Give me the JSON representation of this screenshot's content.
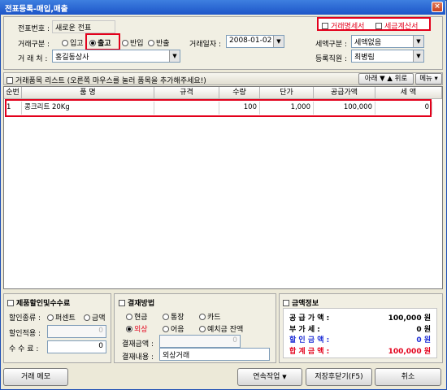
{
  "window": {
    "title": "전표등록-매입,매출",
    "close": "×"
  },
  "header": {
    "slip_no_label": "전표번호 :",
    "slip_no_value": "새로운 전표",
    "trade_type_label": "거래구분 :",
    "trade_types": [
      "입고",
      "출고",
      "반입",
      "반출"
    ],
    "trade_type_selected": "출고",
    "trade_date_label": "거래일자 :",
    "trade_date_value": "2008-01-02",
    "partner_label": "거 래 처 :",
    "partner_value": "홍길동상사",
    "check_statement": "거래명세서",
    "check_tax_invoice": "세금계산서",
    "tax_type_label": "세액구분 :",
    "tax_type_value": "세액없음",
    "staff_label": "등록직원 :",
    "staff_value": "최병림"
  },
  "list": {
    "title": "거래품목 리스트 (오른쪽 마우스를 눌러 품목을 추가해주세요!)",
    "move_button": "아래 ▼ ▲ 위로",
    "menu_button": "메뉴 ▾",
    "columns": [
      "순번",
      "품            명",
      "규격",
      "수량",
      "단가",
      "공급가액",
      "세      액"
    ],
    "rows": [
      {
        "no": "1",
        "name": "콩크리트 20Kg",
        "spec": "",
        "qty": "100",
        "price": "1,000",
        "supply": "100,000",
        "tax": "0"
      }
    ]
  },
  "discount": {
    "title": "제품할인및수수료",
    "kind_label": "할인종류 :",
    "kind_options": [
      "퍼센트",
      "금액"
    ],
    "apply_label": "할인적용 :",
    "apply_value": "0",
    "fee_label": "수 수 료 :",
    "fee_value": "0"
  },
  "payment": {
    "title": "결재방법",
    "methods": [
      "현금",
      "통장",
      "카드",
      "외상",
      "어음",
      "예치금 잔액"
    ],
    "selected": "외상",
    "amount_label": "결재금액 :",
    "amount_value": "0",
    "note_label": "결재내용 :",
    "note_value": "외상거래"
  },
  "money": {
    "title": "금액정보",
    "rows": [
      {
        "label": "공 급 가 액 :",
        "value": "100,000 원",
        "color": "#000000"
      },
      {
        "label": "부   가   세 :",
        "value": "0 원",
        "color": "#000000"
      },
      {
        "label": "할 인 금 액 :",
        "value": "0 원",
        "color": "#1f2fd6"
      },
      {
        "label": "합 계 금 액 :",
        "value": "100,000 원",
        "color": "#e3001b"
      }
    ]
  },
  "footer": {
    "memo": "거래 메모",
    "continuous": "연속작업",
    "save_close": "저장후닫기(F5)",
    "cancel": "취소"
  }
}
